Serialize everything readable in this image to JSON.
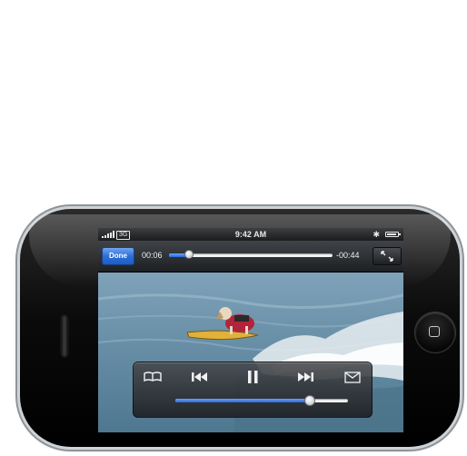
{
  "status_bar": {
    "network": "3G",
    "time": "9:42 AM",
    "signal_bars": 5,
    "battery_level": 0.9,
    "bluetooth_icon": "bluetooth-icon"
  },
  "player": {
    "done_label": "Done",
    "elapsed": "00:06",
    "remaining": "-00:44",
    "progress": 0.12,
    "volume": 0.78,
    "accent_color": "#2e6fd6"
  },
  "controls": {
    "bookmark_icon": "bookmark-book-icon",
    "previous_icon": "skip-back-icon",
    "pause_icon": "pause-icon",
    "next_icon": "skip-forward-icon",
    "share_icon": "mail-envelope-icon",
    "fullscreen_icon": "scale-arrows-icon"
  }
}
